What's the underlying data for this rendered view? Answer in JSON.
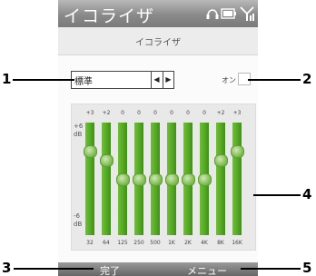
{
  "app": {
    "title": "イコライザ",
    "subtitle": "イコライザ"
  },
  "status_icons": [
    "headset-icon",
    "battery-icon",
    "signal-icon"
  ],
  "preset": {
    "value": "標準"
  },
  "toggle": {
    "label": "オン",
    "checked": false
  },
  "eq": {
    "db_top": "+6\ndB",
    "db_bottom": "-6\ndB",
    "bands": [
      {
        "freq": "32",
        "gain": "+3"
      },
      {
        "freq": "64",
        "gain": "+2"
      },
      {
        "freq": "125",
        "gain": "0"
      },
      {
        "freq": "250",
        "gain": "0"
      },
      {
        "freq": "500",
        "gain": "0"
      },
      {
        "freq": "1K",
        "gain": "0"
      },
      {
        "freq": "2K",
        "gain": "0"
      },
      {
        "freq": "4K",
        "gain": "0"
      },
      {
        "freq": "8K",
        "gain": "+2"
      },
      {
        "freq": "16K",
        "gain": "+3"
      }
    ]
  },
  "softkeys": {
    "left": "完了",
    "right": "メニュー"
  },
  "callouts": {
    "c1": "1",
    "c2": "2",
    "c3": "3",
    "c4": "4",
    "c5": "5"
  }
}
